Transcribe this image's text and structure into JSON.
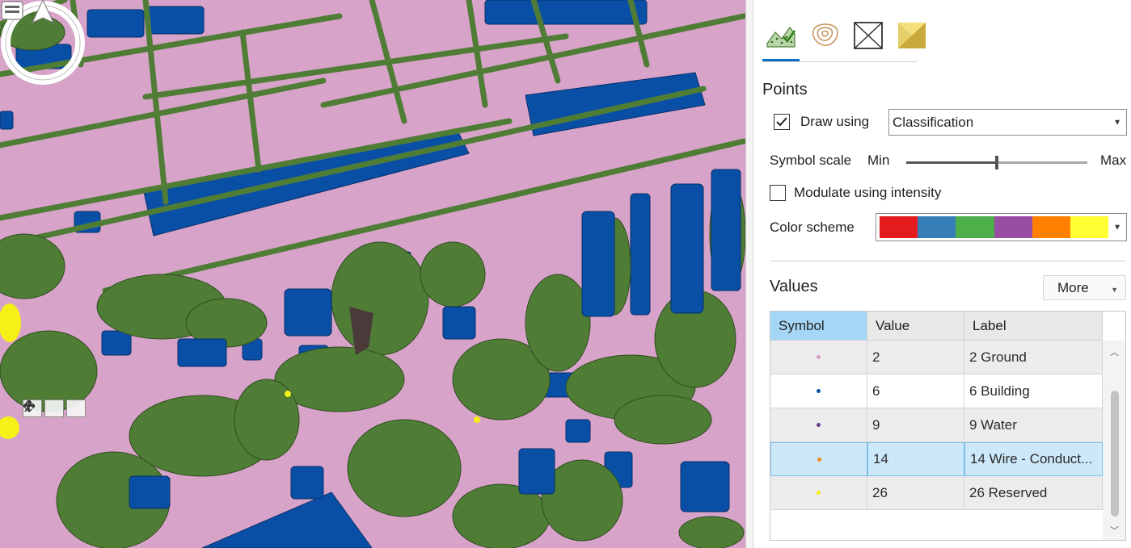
{
  "colors": {
    "ground": "#d7a3c9",
    "vegetation": "#4f7d36",
    "building": "#0a4fa6",
    "water": "#6a3c8f",
    "wire": "#f08a1c",
    "reserved": "#f5f018",
    "accent": "#0b6ec4"
  },
  "map": {
    "tools": [
      {
        "name": "pan-up-icon",
        "glyph": "⌃"
      },
      {
        "name": "full-extent-icon",
        "glyph": "✥"
      },
      {
        "name": "walk-icon",
        "glyph": "🚶"
      }
    ]
  },
  "panel": {
    "tabs": [
      {
        "name": "tab-symbology",
        "icon": "points-symbology-icon",
        "active": true
      },
      {
        "name": "tab-elevation",
        "icon": "contour-icon",
        "active": false
      },
      {
        "name": "tab-filter",
        "icon": "envelope-icon",
        "active": false
      },
      {
        "name": "tab-appearance",
        "icon": "surface-icon",
        "active": false
      }
    ],
    "points_title": "Points",
    "draw_using_label": "Draw using",
    "draw_using_checked": true,
    "draw_using_value": "Classification",
    "symbol_scale_label": "Symbol scale",
    "min_label": "Min",
    "max_label": "Max",
    "symbol_scale_fraction": 0.5,
    "modulate_label": "Modulate using intensity",
    "modulate_checked": false,
    "color_scheme_label": "Color scheme",
    "color_scheme_colors": [
      "#e41a1c",
      "#377eb8",
      "#4daf4a",
      "#984ea3",
      "#ff7f00",
      "#ffff33"
    ],
    "values_title": "Values",
    "more_label": "More",
    "table": {
      "headers": [
        "Symbol",
        "Value",
        "Label"
      ],
      "rows": [
        {
          "color": "#d99ac7",
          "value": "2",
          "label": "2  Ground"
        },
        {
          "color": "#0a4fa6",
          "value": "6",
          "label": "6  Building"
        },
        {
          "color": "#6a3c8f",
          "value": "9",
          "label": "9  Water"
        },
        {
          "color": "#f08a1c",
          "value": "14",
          "label": "14  Wire - Conduct..."
        },
        {
          "color": "#f5f018",
          "value": "26",
          "label": "26  Reserved"
        }
      ],
      "selected_row": 3
    }
  }
}
